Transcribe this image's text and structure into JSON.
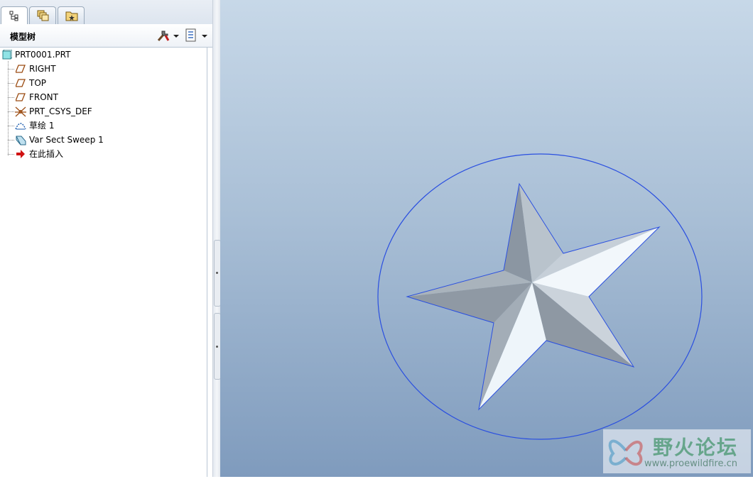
{
  "panel": {
    "tabs": [
      {
        "name": "model-tree-tab",
        "icon": "tree-icon",
        "active": true
      },
      {
        "name": "layers-tab",
        "icon": "layers-icon",
        "active": false
      },
      {
        "name": "favorites-tab",
        "icon": "folder-star-icon",
        "active": false
      }
    ],
    "title": "模型树",
    "settings_icon": "tools-icon",
    "show_icon": "list-settings-icon"
  },
  "tree": {
    "root": {
      "label": "PRT0001.PRT",
      "icon": "part-icon"
    },
    "items": [
      {
        "label": "RIGHT",
        "icon": "datum-plane-icon"
      },
      {
        "label": "TOP",
        "icon": "datum-plane-icon"
      },
      {
        "label": "FRONT",
        "icon": "datum-plane-icon"
      },
      {
        "label": "PRT_CSYS_DEF",
        "icon": "csys-icon"
      },
      {
        "label": "草绘 1",
        "icon": "sketch-icon"
      },
      {
        "label": "Var Sect Sweep 1",
        "icon": "sweep-icon"
      },
      {
        "label": "在此插入",
        "icon": "insert-arrow-icon"
      }
    ]
  },
  "viewport": {
    "model": "star-sweep-model",
    "trajectory_color": "#2a4fe0",
    "background_top": "#c7d8e8",
    "background_bottom": "#7f9bbd"
  },
  "watermark": {
    "title": "野火论坛",
    "url": "www.proewildfire.cn"
  }
}
